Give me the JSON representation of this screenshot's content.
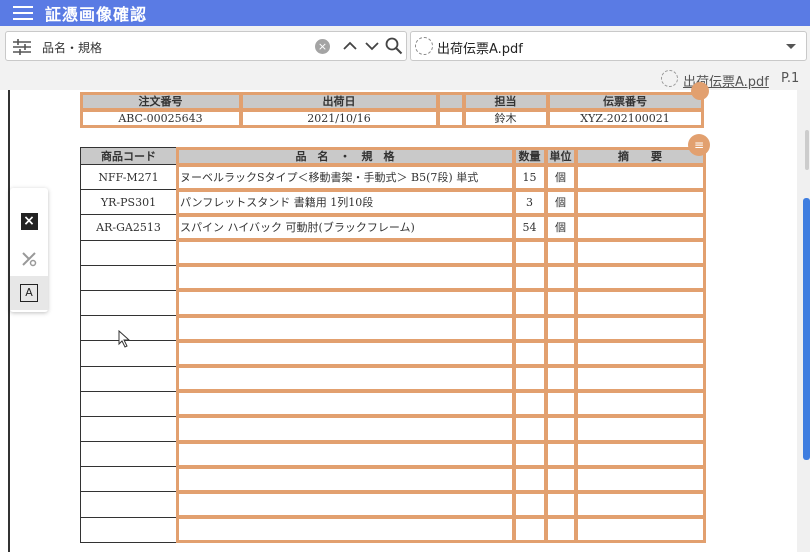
{
  "app": {
    "title": "証憑画像確認"
  },
  "search": {
    "value": "品名・規格"
  },
  "file": {
    "selected": "出荷伝票A.pdf"
  },
  "viewer": {
    "file_link": "出荷伝票A.pdf",
    "page": "P.1"
  },
  "tools": {
    "text_tool": "A"
  },
  "header_table": {
    "headers": [
      "注文番号",
      "出荷日",
      "",
      "担当",
      "伝票番号"
    ],
    "values": [
      "ABC-00025643",
      "2021/10/16",
      "",
      "鈴木",
      "XYZ-202100021"
    ]
  },
  "items_table": {
    "headers": [
      "商品コード",
      "品　名　・　規　格",
      "数量",
      "単位",
      "摘　　要"
    ],
    "rows": [
      [
        "NFF-M271",
        "ヌーベルラックSタイプ＜移動書架・手動式＞ B5(7段) 単式",
        "15",
        "個",
        ""
      ],
      [
        "YR-PS301",
        "パンフレットスタンド 書籍用 1列10段",
        "3",
        "個",
        ""
      ],
      [
        "AR-GA2513",
        "スパイン ハイバック 可動肘(ブラックフレーム)",
        "54",
        "個",
        ""
      ],
      [
        "",
        "",
        "",
        "",
        ""
      ],
      [
        "",
        "",
        "",
        "",
        ""
      ],
      [
        "",
        "",
        "",
        "",
        ""
      ],
      [
        "",
        "",
        "",
        "",
        ""
      ],
      [
        "",
        "",
        "",
        "",
        ""
      ],
      [
        "",
        "",
        "",
        "",
        ""
      ],
      [
        "",
        "",
        "",
        "",
        ""
      ],
      [
        "",
        "",
        "",
        "",
        ""
      ],
      [
        "",
        "",
        "",
        "",
        ""
      ],
      [
        "",
        "",
        "",
        "",
        ""
      ],
      [
        "",
        "",
        "",
        "",
        ""
      ],
      [
        "",
        "",
        "",
        "",
        ""
      ]
    ]
  },
  "colors": {
    "appbar": "#5a7be4",
    "highlight": "#e2a06f",
    "scroll_thumb": "#3f7ee0"
  }
}
